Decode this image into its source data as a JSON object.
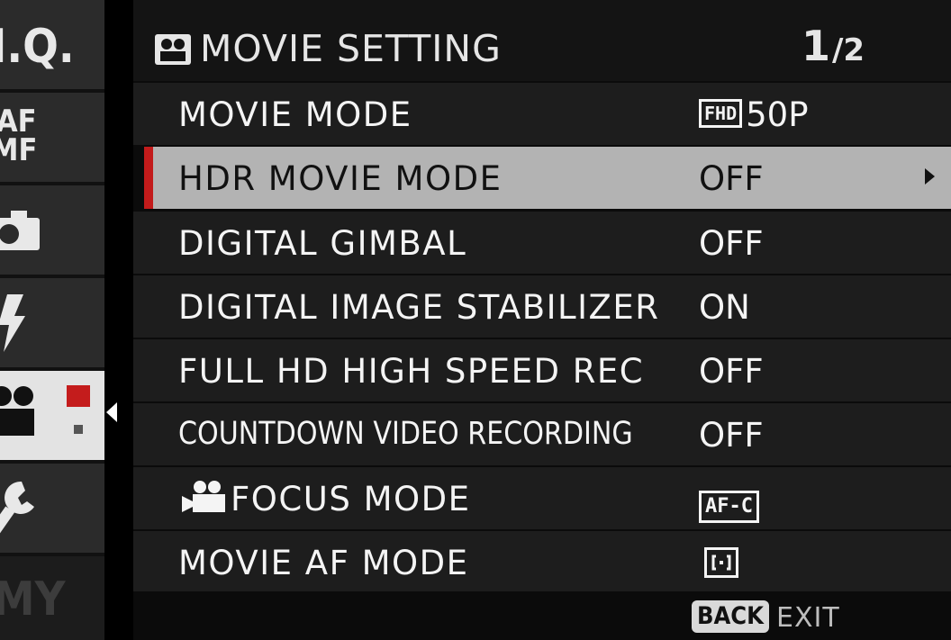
{
  "tabs": [
    {
      "id": "iq",
      "label": "I.Q."
    },
    {
      "id": "af",
      "label_line1": "AF",
      "label_line2": "MF"
    },
    {
      "id": "shooting",
      "icon": "camera-icon"
    },
    {
      "id": "flash",
      "icon": "flash-icon"
    },
    {
      "id": "movie",
      "icon": "movie-camera-icon",
      "active": true
    },
    {
      "id": "setup",
      "icon": "wrench-icon"
    },
    {
      "id": "my",
      "label": "MY"
    }
  ],
  "header": {
    "title": "MOVIE SETTING",
    "page_current": "1",
    "page_total": "/2"
  },
  "rows": [
    {
      "label": "MOVIE MODE",
      "badge": "FHD",
      "value": "50P"
    },
    {
      "label": "HDR MOVIE MODE",
      "value": "OFF",
      "selected": true
    },
    {
      "label": "DIGITAL GIMBAL",
      "value": "OFF"
    },
    {
      "label": "DIGITAL IMAGE STABILIZER",
      "value": "ON"
    },
    {
      "label": "FULL HD HIGH SPEED REC",
      "value": "OFF"
    },
    {
      "label": "COUNTDOWN VIDEO RECORDING",
      "value": "OFF"
    },
    {
      "label": "FOCUS MODE",
      "value": "AF-C"
    },
    {
      "label": "MOVIE AF MODE",
      "value": ""
    }
  ],
  "footer": {
    "back_label": "BACK",
    "exit_label": "EXIT"
  },
  "colors": {
    "selection_marker": "#c31b1b",
    "selected_row": "#b3b3b3",
    "row_bg": "#1d1d1d"
  }
}
